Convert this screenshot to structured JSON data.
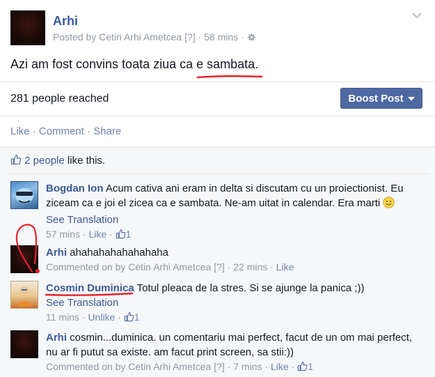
{
  "post": {
    "author": "Arhi",
    "meta_prefix": "Posted by Cetin Arhi Ametcea",
    "help": "[?]",
    "sep": "·",
    "time": "58 mins",
    "text_before": "Azi am fost convins toata ziua ca ",
    "text_highlight": "e sambata",
    "text_after": "."
  },
  "reach": {
    "text": "281 people reached",
    "boost_label": "Boost Post"
  },
  "actions": {
    "like": "Like",
    "comment": "Comment",
    "share": "Share",
    "sep": " · "
  },
  "likes": {
    "count_link": "2 people",
    "suffix": " like this."
  },
  "comments": [
    {
      "author": "Bogdan Ion",
      "text": " Acum cativa ani eram in delta si discutam cu un proiectionist. Eu ziceam ca e joi el zicea ca e sambata. Ne-am uitat in calendar. Era marti ",
      "emoji": "🙂",
      "translate": "See Translation",
      "time": "57 mins",
      "action": "Like",
      "like_count": "1"
    },
    {
      "author": "Arhi",
      "text": " ahahahahahahahaha",
      "meta_prefix": "Commented on by Cetin Arhi Ametcea",
      "help": "[?]",
      "time": "22 mins",
      "action": "Like"
    },
    {
      "author": "Cosmin Duminica",
      "text": " Totul pleaca de la stres. Si se ajunge la panica ;))",
      "translate": "See Translation",
      "time": "11 mins",
      "action": "Unlike",
      "like_count": "1"
    },
    {
      "author": "Arhi",
      "text": " cosmin...duminica. un comentariu mai perfect, facut de un om mai perfect, nu ar fi putut sa existe. am facut print screen, sa stii:))",
      "meta_prefix": "Commented on by Cetin Arhi Ametcea",
      "help": "[?]",
      "time": "7 mins",
      "action": "Like",
      "like_count": "1"
    }
  ],
  "colors": {
    "link": "#3b5998",
    "muted": "#9197a3",
    "boost": "#4e69a2",
    "annotation": "#e8212b"
  },
  "icons": [
    "chevron-down-icon",
    "gear-icon",
    "thumbs-up-icon",
    "smiley-icon"
  ]
}
